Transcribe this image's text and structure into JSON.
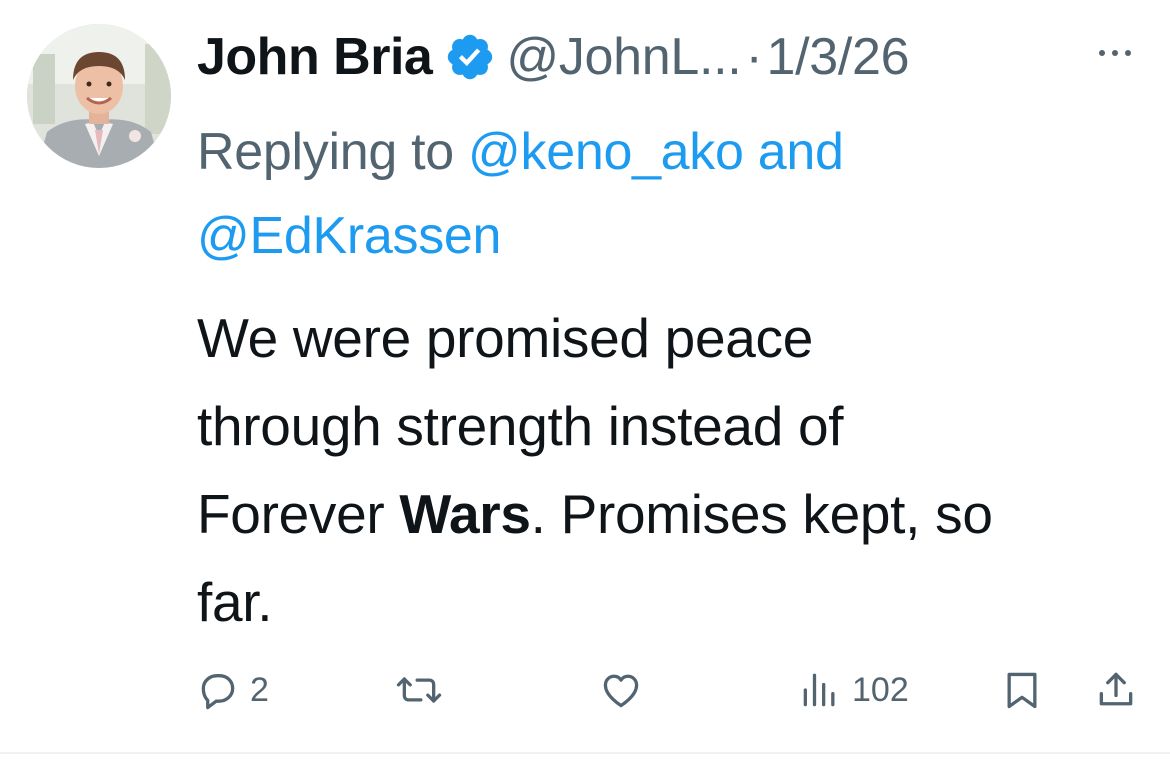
{
  "tweet": {
    "author": {
      "display_name": "John Bria",
      "handle": "@JohnL...",
      "verified": true,
      "avatar": "avatar-photo"
    },
    "separator": "·",
    "date": "1/3/26",
    "more_icon": "more-horizontal-icon",
    "reply_context": {
      "prefix": "Replying to",
      "mentions": [
        "@keno_ako",
        "@EdKrassen"
      ],
      "conjunction": "and"
    },
    "body": {
      "line1": "We were promised peace",
      "line2": "through strength instead of",
      "line3_a": "Forever ",
      "line3_bold": "Wars",
      "line3_b": ". Promises kept, so",
      "line4": "far."
    },
    "actions": {
      "reply_count": "2",
      "retweet_count": "",
      "like_count": "",
      "views_count": "102"
    },
    "colors": {
      "accent": "#1d9bf0",
      "text": "#0f1419",
      "secondary": "#536471"
    }
  }
}
